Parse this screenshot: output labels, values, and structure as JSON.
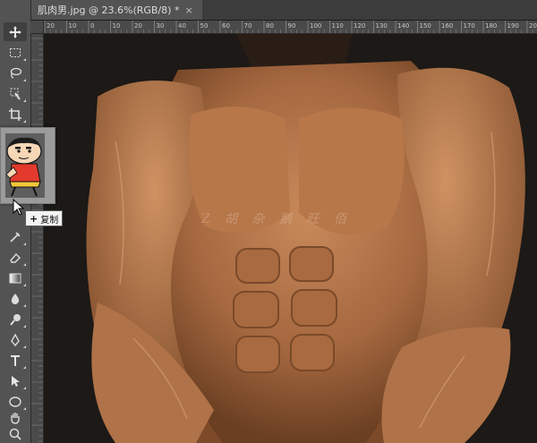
{
  "document_tab": {
    "title": "肌肉男.jpg @ 23.6%(RGB/8) *",
    "close": "×"
  },
  "ruler": {
    "top_labels": [
      "20",
      "10",
      "0",
      "10",
      "20",
      "30",
      "40",
      "50",
      "60",
      "70",
      "80",
      "90",
      "100",
      "110",
      "120",
      "130",
      "140",
      "150",
      "160",
      "170",
      "180",
      "190",
      "200"
    ]
  },
  "canvas": {
    "watermark_text": "Z 胡 杂 鹅 旺 佰"
  },
  "tools": [
    {
      "name": "move-tool",
      "icon": "move-icon"
    },
    {
      "name": "marquee-tool",
      "icon": "marquee-icon"
    },
    {
      "name": "lasso-tool",
      "icon": "lasso-icon"
    },
    {
      "name": "quick-select-tool",
      "icon": "quick-select-icon"
    },
    {
      "name": "crop-tool",
      "icon": "crop-icon"
    },
    {
      "name": "healing-brush-tool",
      "icon": "bandage-icon"
    },
    {
      "name": "stamp-tool",
      "icon": "stamp-icon"
    },
    {
      "name": "history-brush-tool",
      "icon": "history-brush-icon"
    },
    {
      "name": "eraser-tool",
      "icon": "eraser-icon"
    },
    {
      "name": "gradient-tool",
      "icon": "gradient-icon"
    },
    {
      "name": "blur-tool",
      "icon": "droplet-icon"
    },
    {
      "name": "dodge-tool",
      "icon": "dodge-icon"
    },
    {
      "name": "pen-tool",
      "icon": "pen-icon"
    },
    {
      "name": "type-tool",
      "icon": "type-icon"
    },
    {
      "name": "path-select-tool",
      "icon": "arrow-icon"
    },
    {
      "name": "ellipse-tool",
      "icon": "ellipse-icon"
    },
    {
      "name": "hand-tool",
      "icon": "hand-icon"
    },
    {
      "name": "zoom-tool",
      "icon": "zoom-icon"
    }
  ],
  "drag": {
    "tooltip_plus": "+",
    "tooltip_label": "复制"
  }
}
